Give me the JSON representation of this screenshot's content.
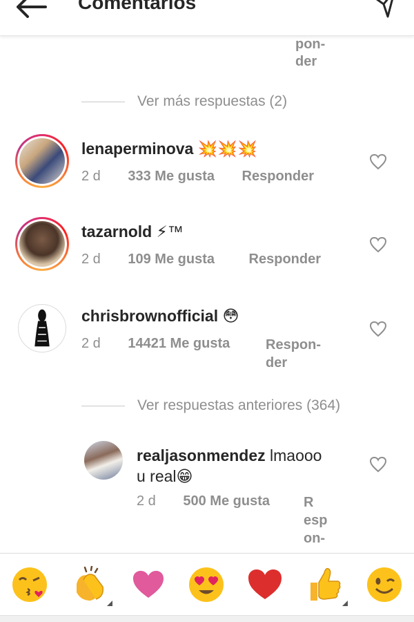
{
  "header": {
    "title": "Comentarios",
    "back_icon": "arrow-left-icon",
    "send_icon": "paper-plane-icon"
  },
  "top_fragment": "pon-\nder",
  "view_more": "Ver más respuestas (2)",
  "view_previous": "Ver respuestas anteriores (364)",
  "comments": [
    {
      "username": "lenaperminova",
      "text": "💥💥💥",
      "time": "2 d",
      "likes": "333 Me gusta",
      "reply": "Responder"
    },
    {
      "username": "tazarnold",
      "text": "⚡™",
      "time": "2 d",
      "likes": "109 Me gusta",
      "reply": "Responder"
    },
    {
      "username": "chrisbrownofficial",
      "text": "😳",
      "time": "2 d",
      "likes": "14421 Me gusta",
      "reply": "Respon-\nder"
    },
    {
      "username": "realjasonmendez",
      "text": "lmaooo",
      "text2": "u real😁",
      "time": "2 d",
      "likes": "500 Me gusta",
      "reply": "R\nesp\non-"
    }
  ],
  "emoji_bar": [
    {
      "name": "kissing-heart-emoji",
      "glyph": "😘"
    },
    {
      "name": "clapping-hands-emoji",
      "glyph": "👏"
    },
    {
      "name": "pink-heart-emoji",
      "glyph": "💗"
    },
    {
      "name": "heart-eyes-emoji",
      "glyph": "😍"
    },
    {
      "name": "red-heart-emoji",
      "glyph": "❤️"
    },
    {
      "name": "thumbs-up-emoji",
      "glyph": "👍"
    },
    {
      "name": "winking-face-emoji",
      "glyph": "😉"
    }
  ],
  "colors": {
    "text": "#262626",
    "secondary": "#8e8e8e",
    "ring_start": "#e1306c",
    "ring_end": "#fcaf45"
  }
}
